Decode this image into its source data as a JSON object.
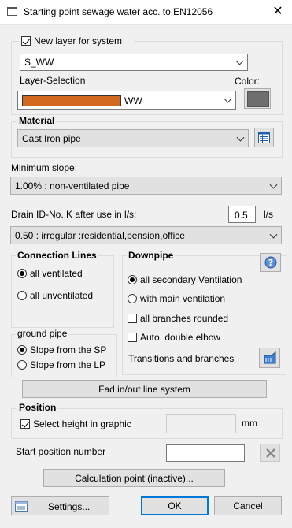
{
  "window": {
    "title": "Starting point sewage water acc. to EN12056",
    "close_glyph": "✕"
  },
  "layer": {
    "new_layer_label": "New layer for system",
    "new_layer_checked": true,
    "system_value": "S_WW",
    "layer_selection_label": "Layer-Selection",
    "layer_value": "WW",
    "layer_color": "#d2691e",
    "color_label": "Color:",
    "color_swatch": "#6e6e6e"
  },
  "material": {
    "label": "Material",
    "value": "Cast Iron pipe"
  },
  "slope": {
    "label": "Minimum slope:",
    "value": "1.00% :  non-ventilated pipe"
  },
  "drain": {
    "label": "Drain ID-No. K after use in l/s:",
    "value": "0.5",
    "unit": "l/s",
    "usage_value": "0.50 :  irregular :residential,pension,office"
  },
  "connection_lines": {
    "title": "Connection Lines",
    "options": [
      "all ventilated",
      "all unventilated"
    ],
    "selected": 0
  },
  "ground_pipe": {
    "title": "ground pipe",
    "options": [
      "Slope from the SP",
      "Slope from the LP"
    ],
    "selected": 0
  },
  "downpipe": {
    "title": "Downpipe",
    "options": [
      "all secondary Ventilation",
      "with main ventilation"
    ],
    "selected": 0,
    "all_branches_rounded": "all branches rounded",
    "auto_double_elbow": "Auto. double elbow",
    "transitions_label": "Transitions and branches"
  },
  "fad_button": "Fad in/out line system",
  "position": {
    "title": "Position",
    "select_height_label": "Select height in graphic",
    "select_height_checked": true,
    "height_value": "",
    "unit": "mm"
  },
  "start_position": {
    "label": "Start position number",
    "value": ""
  },
  "calc_button": "Calculation point (inactive)...",
  "footer": {
    "settings": "Settings...",
    "ok": "OK",
    "cancel": "Cancel"
  }
}
